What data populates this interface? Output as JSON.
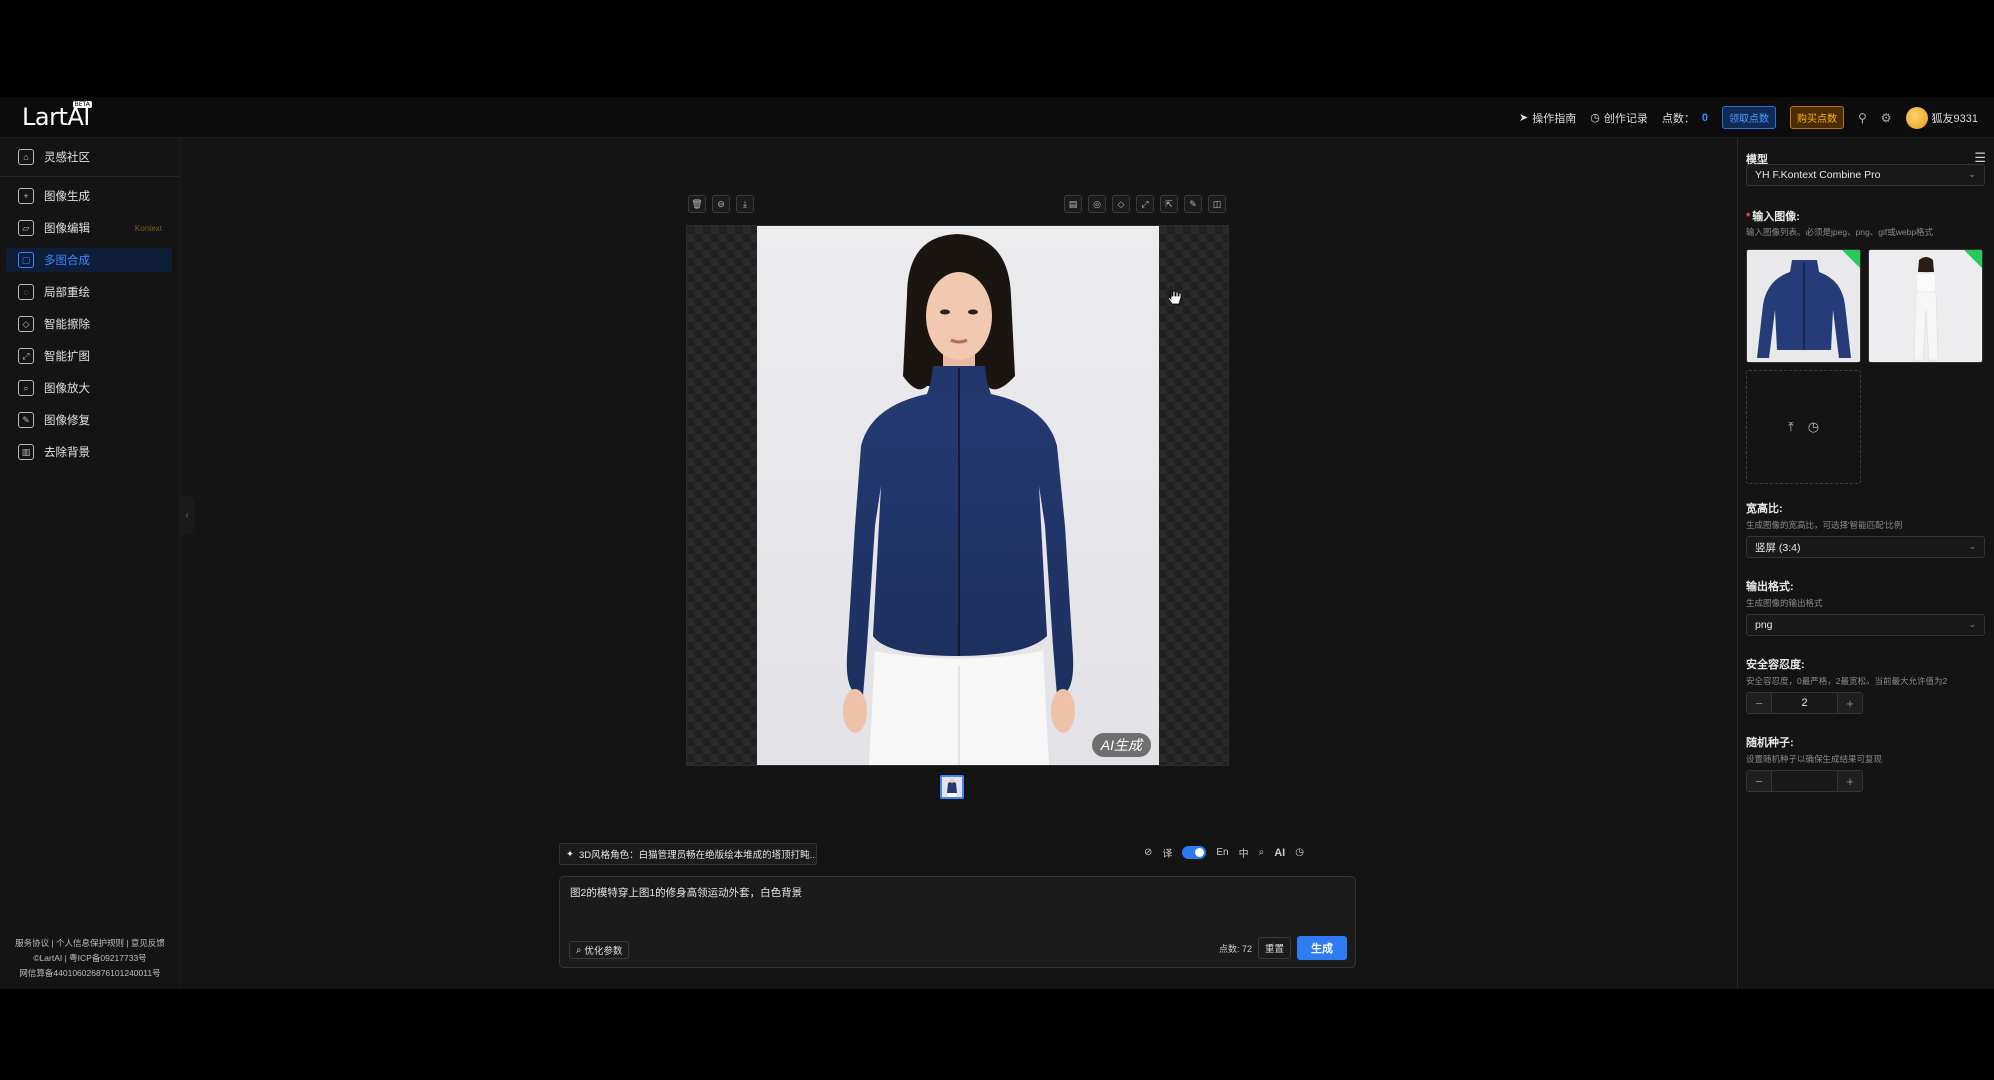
{
  "app": {
    "logo": "LartAI",
    "logo_badge": "BETA"
  },
  "topbar": {
    "guide_label": "操作指南",
    "history_label": "创作记录",
    "points_label": "点数：",
    "points_value": "0",
    "claim_label": "领取点数",
    "buy_label": "购买点数",
    "username": "狐友9331"
  },
  "sidebar": {
    "items": [
      {
        "label": "灵感社区",
        "icon": "home-icon"
      },
      {
        "label": "图像生成",
        "icon": "image-generate-icon"
      },
      {
        "label": "图像编辑",
        "icon": "image-edit-icon",
        "tag": "Kontext"
      },
      {
        "label": "多图合成",
        "icon": "multi-image-icon",
        "active": true
      },
      {
        "label": "局部重绘",
        "icon": "inpaint-icon"
      },
      {
        "label": "智能擦除",
        "icon": "eraser-icon"
      },
      {
        "label": "智能扩图",
        "icon": "outpaint-icon"
      },
      {
        "label": "图像放大",
        "icon": "upscale-icon"
      },
      {
        "label": "图像修复",
        "icon": "restore-icon"
      },
      {
        "label": "去除背景",
        "icon": "remove-bg-icon"
      }
    ],
    "footer": {
      "line1": "服务协议 | 个人信息保护规则 | 意见反馈",
      "line2": "©LartAI | 粤ICP备09217733号",
      "line3": "网信算备440106026876101240011号"
    }
  },
  "canvas": {
    "ai_badge": "AI生成"
  },
  "prompt": {
    "preset_chip": "3D风格角色：白猫管理员畅在绝版绘本堆成的塔顶打盹...",
    "lang_translate": "译",
    "lang_en": "En",
    "lang_zh": "中",
    "ai_label": "AI",
    "text": "图2的模特穿上图1的修身高领运动外套，白色背景",
    "optimize_label": "优化参数",
    "cost_label": "点数: 72",
    "reset_label": "重置",
    "generate_label": "生成"
  },
  "right_panel": {
    "model_label": "模型",
    "model_value": "YH F.Kontext Combine Pro",
    "input_label": "输入图像:",
    "input_hint": "输入图像列表。必须是jpeg、png、gif或webp格式",
    "ratio_label": "宽高比:",
    "ratio_hint": "生成图像的宽高比，可选择'智能匹配'比例",
    "ratio_value": "竖屏 (3:4)",
    "format_label": "输出格式:",
    "format_hint": "生成图像的输出格式",
    "format_value": "png",
    "safety_label": "安全容忍度:",
    "safety_hint": "安全容忍度，0最严格，2最宽松。当前最大允许值为2",
    "safety_value": "2",
    "seed_label": "随机种子:",
    "seed_hint": "设置随机种子以确保生成结果可复现",
    "seed_value": ""
  },
  "colors": {
    "accent": "#2f7cf2",
    "active_nav_bg": "#0f1e38",
    "claim": "#4b9dff",
    "buy": "#ffb020",
    "check": "#29c85a"
  }
}
